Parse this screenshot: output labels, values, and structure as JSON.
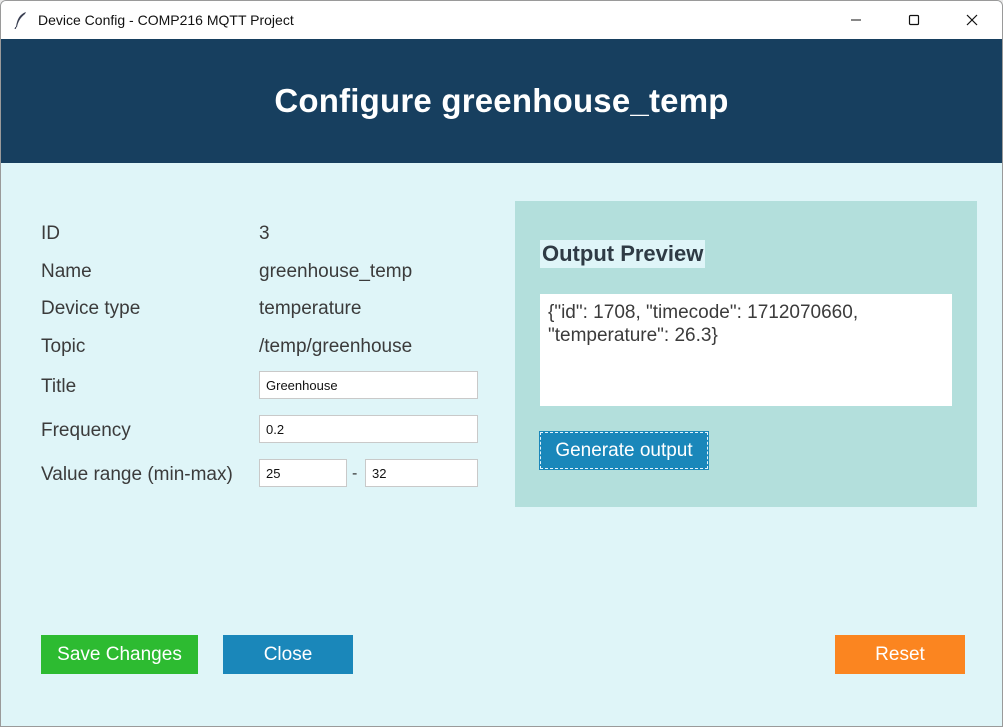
{
  "window": {
    "title": "Device Config - COMP216 MQTT Project"
  },
  "header": {
    "title": "Configure greenhouse_temp"
  },
  "fields": {
    "id_label": "ID",
    "id_value": "3",
    "name_label": "Name",
    "name_value": "greenhouse_temp",
    "device_type_label": "Device type",
    "device_type_value": "temperature",
    "topic_label": "Topic",
    "topic_value": "/temp/greenhouse",
    "title_label": "Title",
    "title_value": "Greenhouse",
    "frequency_label": "Frequency",
    "frequency_value": "0.2",
    "range_label": "Value range (min-max)",
    "range_min": "25",
    "range_separator": "-",
    "range_max": "32"
  },
  "preview": {
    "title": "Output Preview",
    "output": "{\"id\": 1708, \"timecode\": 1712070660,\n\"temperature\": 26.3}",
    "generate_label": "Generate output"
  },
  "actions": {
    "save_label": "Save Changes",
    "close_label": "Close",
    "reset_label": "Reset"
  },
  "colors": {
    "header_bg": "#173f5f",
    "body_bg": "#dff5f8",
    "panel_bg": "#b3dfdc",
    "save": "#2dbb31",
    "close": "#1a87ba",
    "reset": "#fb8520"
  }
}
